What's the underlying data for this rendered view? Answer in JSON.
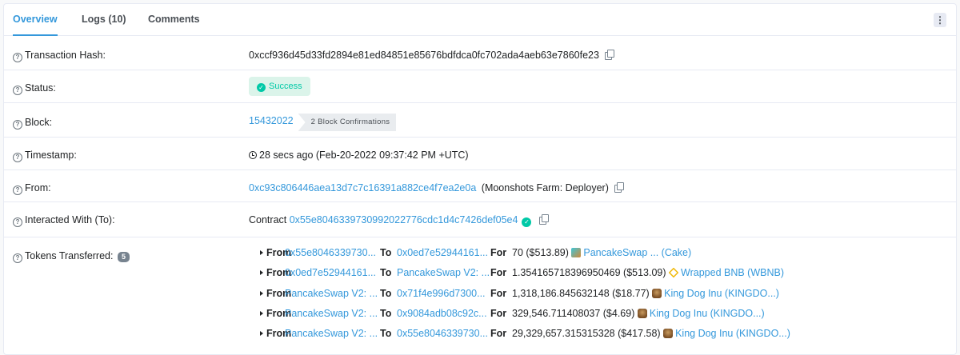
{
  "tabs": [
    {
      "label": "Overview",
      "active": true
    },
    {
      "label": "Logs (10)",
      "active": false
    },
    {
      "label": "Comments",
      "active": false
    }
  ],
  "menu_icon": "more-vertical-icon",
  "rows": {
    "hash": {
      "label": "Transaction Hash:",
      "value": "0xccf936d45d33fd2894e81ed84851e85676bdfdca0fc702ada4aeb63e7860fe23"
    },
    "status": {
      "label": "Status:",
      "value": "Success",
      "color": "#00c9a7"
    },
    "block": {
      "label": "Block:",
      "value": "15432022",
      "confirmations": "2 Block Confirmations"
    },
    "timestamp": {
      "label": "Timestamp:",
      "value": "28 secs ago (Feb-20-2022 09:37:42 PM +UTC)"
    },
    "from": {
      "label": "From:",
      "address": "0xc93c806446aea13d7c7c16391a882ce4f7ea2e0a",
      "name": "(Moonshots Farm: Deployer)"
    },
    "interacted": {
      "label": "Interacted With (To):",
      "prefix": "Contract",
      "address": "0x55e8046339730992022776cdc1d4c7426def05e4"
    },
    "tokens": {
      "label": "Tokens Transferred:",
      "count": "5"
    }
  },
  "transfers": [
    {
      "from_kw": "From",
      "from": "0x55e8046339730...",
      "to_kw": "To",
      "to": "0x0ed7e52944161...",
      "for_kw": "For",
      "amount": "70 ($513.89)",
      "token": "PancakeSwap ... (Cake)",
      "icon": "cake"
    },
    {
      "from_kw": "From",
      "from": "0x0ed7e52944161...",
      "to_kw": "To",
      "to": "PancakeSwap V2: ...",
      "for_kw": "For",
      "amount": "1.354165718396950469 ($513.09)",
      "token": "Wrapped BNB (WBNB)",
      "icon": "bnb"
    },
    {
      "from_kw": "From",
      "from": "PancakeSwap V2: ...",
      "to_kw": "To",
      "to": "0x71f4e996d7300...",
      "for_kw": "For",
      "amount": "1,318,186.845632148 ($18.77)",
      "token": "King Dog Inu (KINGDO...)",
      "icon": "dog"
    },
    {
      "from_kw": "From",
      "from": "PancakeSwap V2: ...",
      "to_kw": "To",
      "to": "0x9084adb08c92c...",
      "for_kw": "For",
      "amount": "329,546.711408037 ($4.69)",
      "token": "King Dog Inu (KINGDO...)",
      "icon": "dog"
    },
    {
      "from_kw": "From",
      "from": "PancakeSwap V2: ...",
      "to_kw": "To",
      "to": "0x55e8046339730...",
      "for_kw": "For",
      "amount": "29,329,657.315315328 ($417.58)",
      "token": "King Dog Inu (KINGDO...)",
      "icon": "dog"
    }
  ],
  "colors": {
    "link": "#3498db",
    "success": "#00c9a7",
    "border": "#e7eaf3"
  }
}
